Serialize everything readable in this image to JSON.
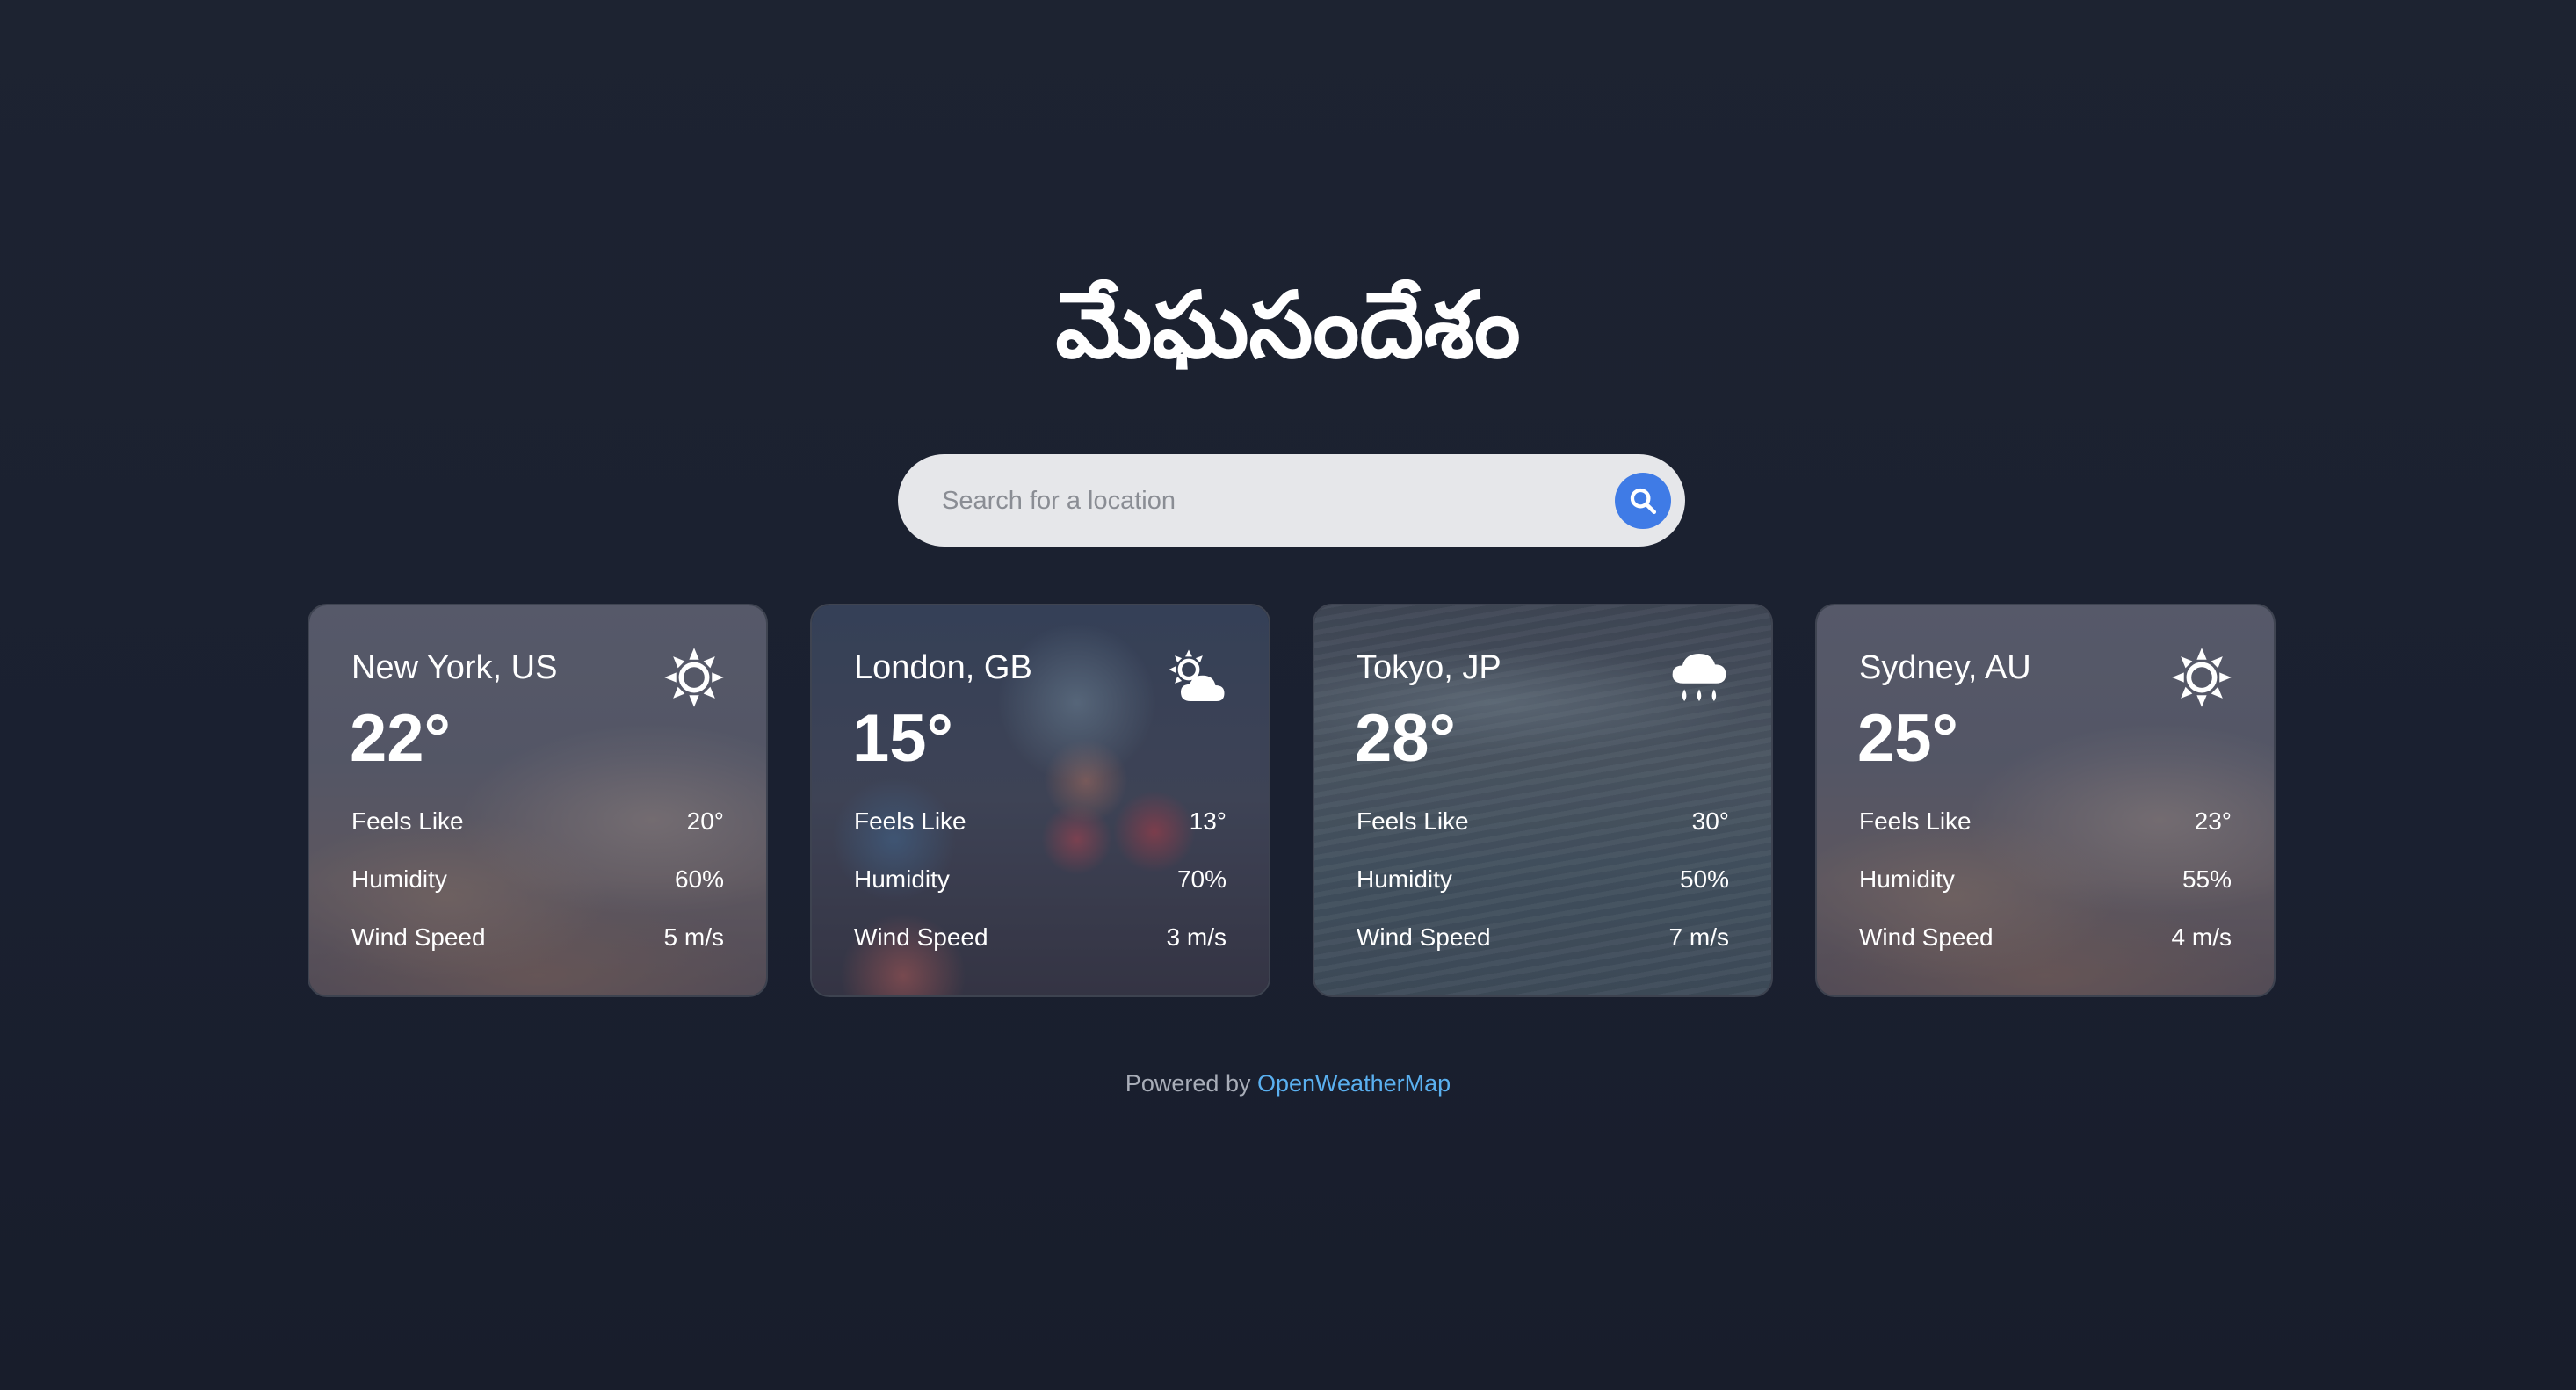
{
  "app": {
    "title": "మేఘసందేశం"
  },
  "search": {
    "placeholder": "Search for a location",
    "value": ""
  },
  "labels": {
    "feels_like": "Feels Like",
    "humidity": "Humidity",
    "wind_speed": "Wind Speed"
  },
  "cards": [
    {
      "city": "New York, US",
      "temp": "22°",
      "feels_like": "20°",
      "humidity": "60%",
      "wind_speed": "5 m/s",
      "icon": "sun-icon"
    },
    {
      "city": "London, GB",
      "temp": "15°",
      "feels_like": "13°",
      "humidity": "70%",
      "wind_speed": "3 m/s",
      "icon": "partly-cloudy-icon"
    },
    {
      "city": "Tokyo, JP",
      "temp": "28°",
      "feels_like": "30°",
      "humidity": "50%",
      "wind_speed": "7 m/s",
      "icon": "rain-cloud-icon"
    },
    {
      "city": "Sydney, AU",
      "temp": "25°",
      "feels_like": "23°",
      "humidity": "55%",
      "wind_speed": "4 m/s",
      "icon": "sun-icon"
    }
  ],
  "footer": {
    "prefix": "Powered by",
    "link": "OpenWeatherMap"
  },
  "colors": {
    "accent": "#3f7be6",
    "link": "#5ab0f0",
    "background": "#1b2130"
  }
}
